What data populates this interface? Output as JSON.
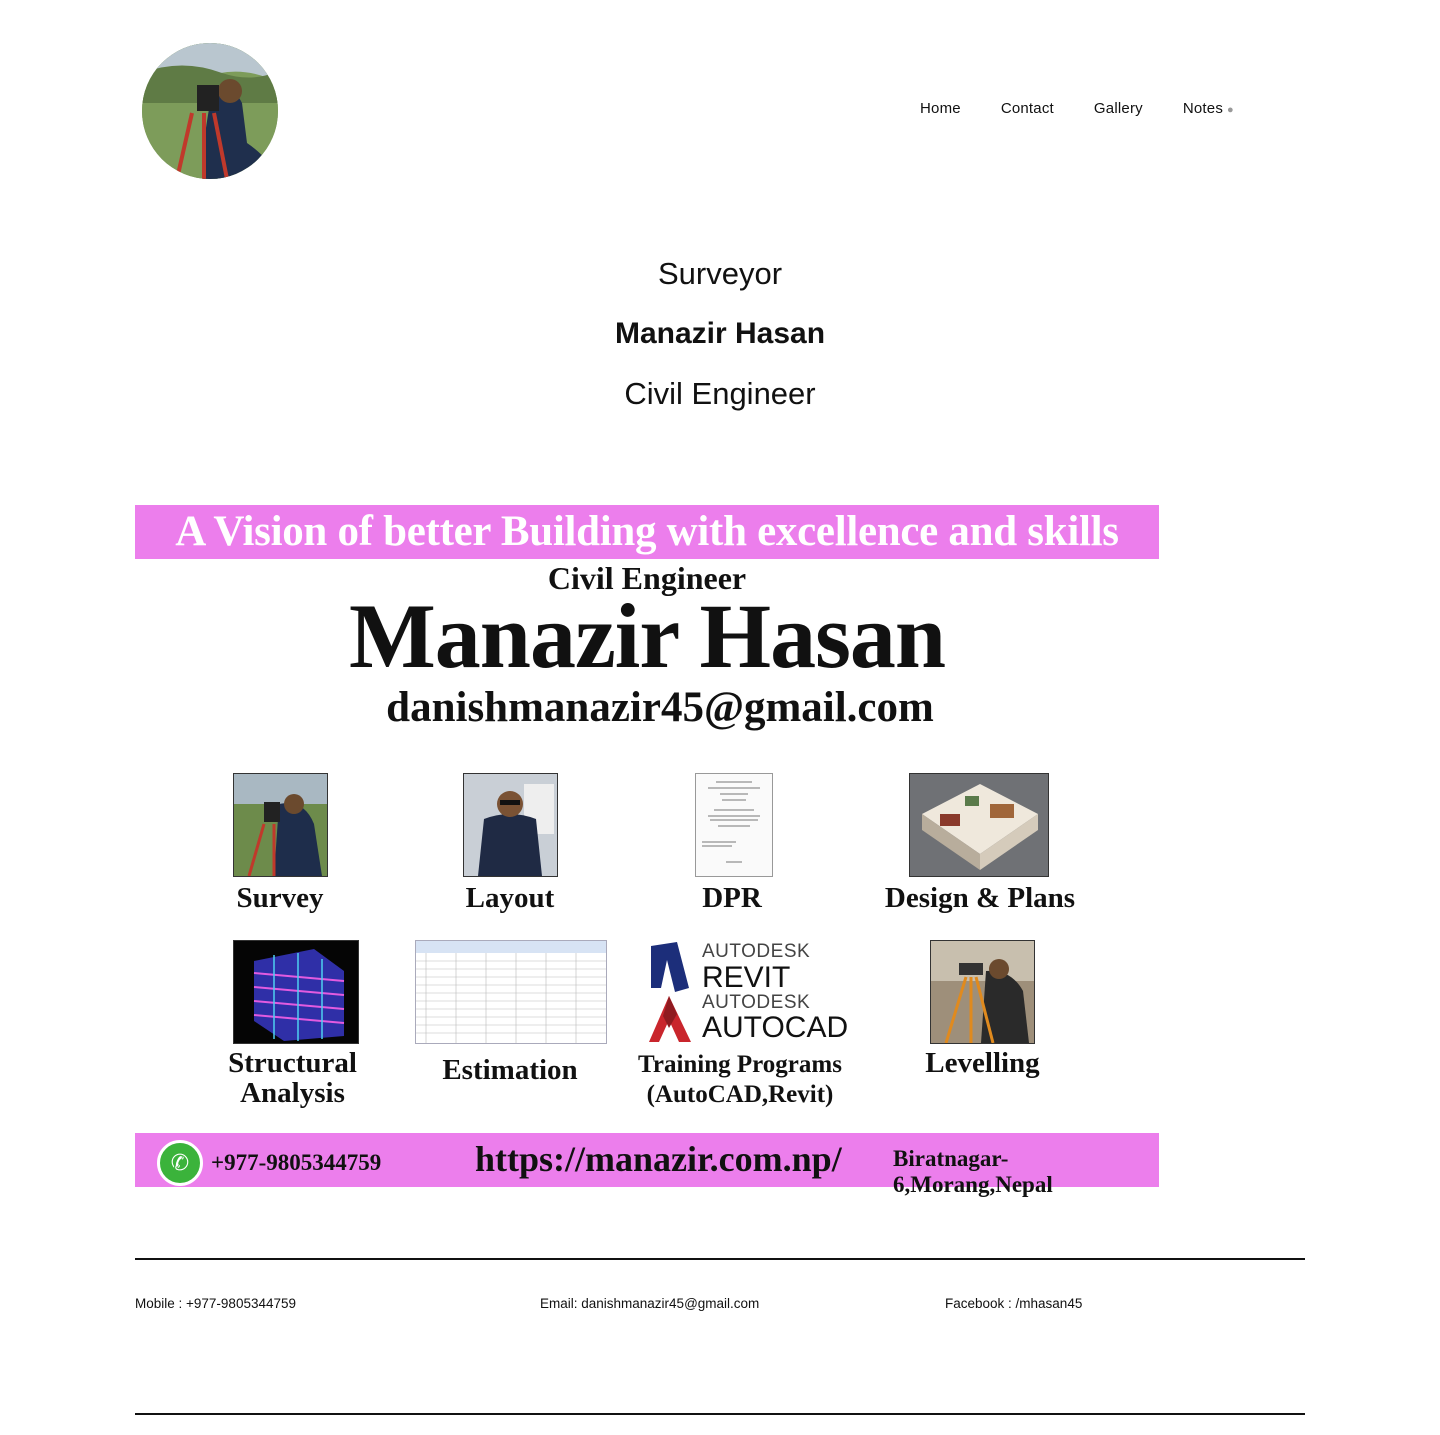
{
  "nav": {
    "home": "Home",
    "contact": "Contact",
    "gallery": "Gallery",
    "notes": "Notes"
  },
  "hero": {
    "line1": "Surveyor",
    "line2": "Manazir Hasan",
    "line3": "Civil Engineer"
  },
  "poster": {
    "banner": "A Vision of better Building with excellence and skills",
    "role": "Civil Engineer",
    "name": "Manazir Hasan",
    "email": "danishmanazir45@gmail.com",
    "services": [
      "Survey",
      "Layout",
      "DPR",
      "Design & Plans",
      "Structural Analysis",
      "Estimation",
      "Training Programs (AutoCAD,Revit)",
      "Levelling"
    ],
    "software": {
      "brand1": "AUTODESK",
      "product1": "REVIT",
      "brand2": "AUTODESK",
      "product2": "AUTOCAD"
    },
    "phone": "+977-9805344759",
    "url": "https://manazir.com.np/",
    "address": "Biratnagar-6,Morang,Nepal"
  },
  "footer": {
    "mobile": "Mobile : +977-9805344759",
    "email": "Email: danishmanazir45@gmail.com",
    "facebook": "Facebook : /mhasan45"
  },
  "colors": {
    "banner": "#ec7eec",
    "text": "#111111"
  }
}
